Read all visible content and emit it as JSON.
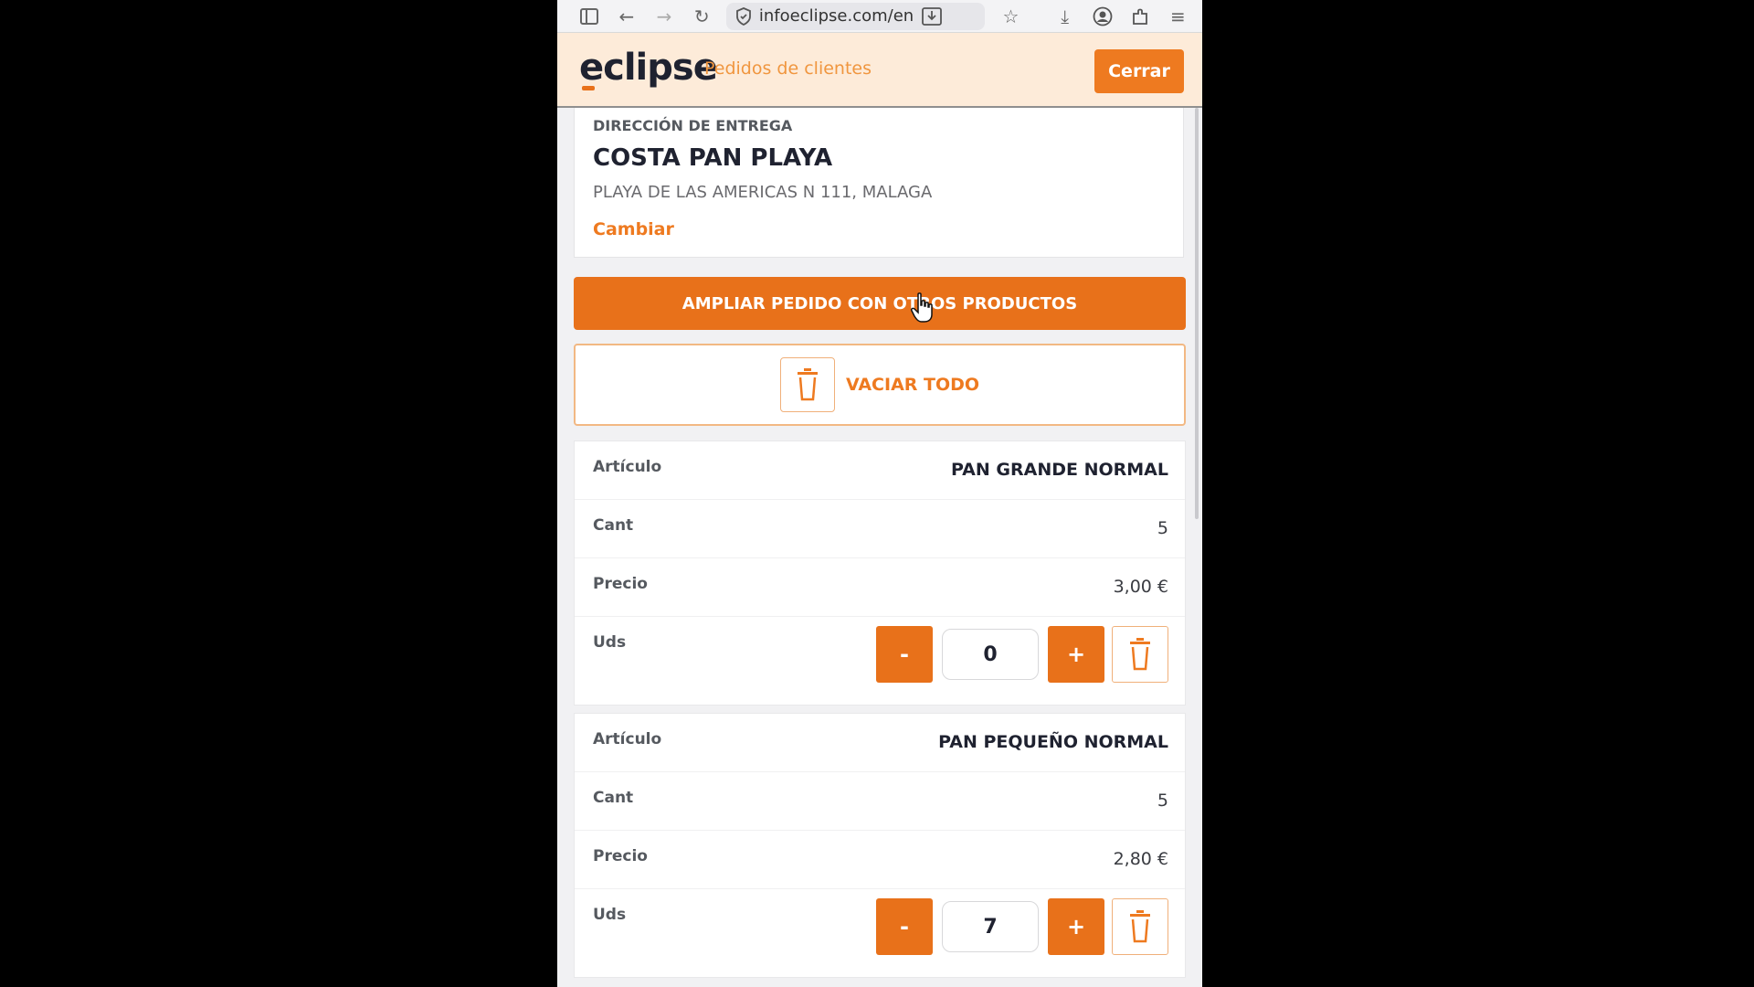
{
  "browser": {
    "url": "infoeclipse.com/en",
    "icons": [
      "sidebar-icon",
      "back-icon",
      "forward-icon",
      "reload-icon",
      "shield-icon",
      "save-page-icon",
      "star-icon",
      "download-icon",
      "account-icon",
      "extensions-icon",
      "menu-icon"
    ]
  },
  "header": {
    "logo": "eclipse",
    "title": "Pedidos de clientes",
    "close_label": "Cerrar"
  },
  "address": {
    "label": "DIRECCIÓN DE ENTREGA",
    "name": "COSTA PAN PLAYA",
    "line": "PLAYA DE LAS AMERICAS N 111, MALAGA",
    "change_label": "Cambiar"
  },
  "actions": {
    "expand_label": "AMPLIAR PEDIDO CON OTROS PRODUCTOS",
    "empty_label": "VACIAR TODO"
  },
  "labels": {
    "article": "Artículo",
    "qty": "Cant",
    "price": "Precio",
    "units": "Uds",
    "minus": "-",
    "plus": "+"
  },
  "items": [
    {
      "article": "PAN GRANDE NORMAL",
      "qty": "5",
      "price": "3,00 €",
      "units": "0"
    },
    {
      "article": "PAN PEQUEÑO NORMAL",
      "qty": "5",
      "price": "2,80 €",
      "units": "7"
    }
  ],
  "colors": {
    "accent": "#e8711a",
    "header_bg": "#fdebd9",
    "header_title": "#f0963f"
  }
}
